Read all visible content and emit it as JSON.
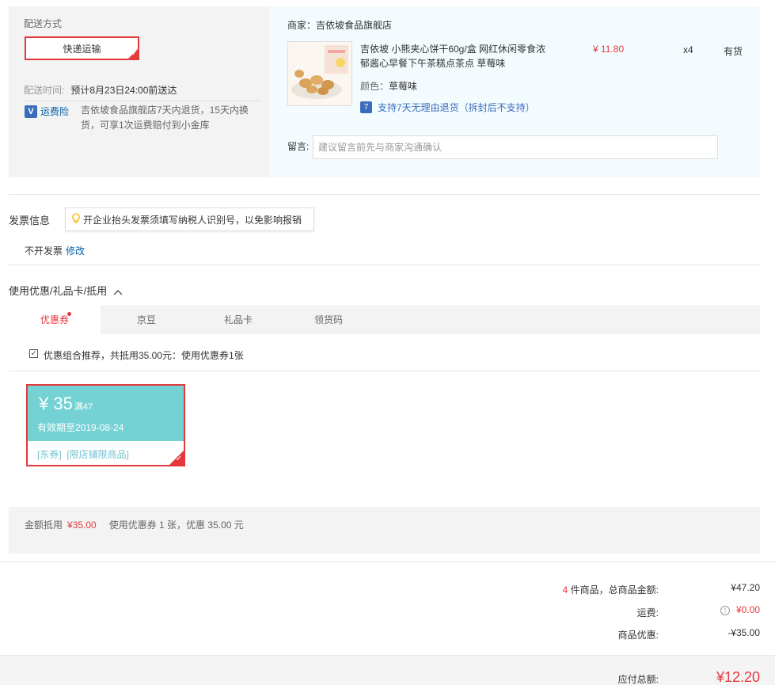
{
  "delivery": {
    "label": "配送方式",
    "method": "快递运输",
    "time_label": "配送时间:",
    "time_value": "预计8月23日24:00前送达",
    "insurance_icon": "V",
    "insurance_link": "运费险",
    "insurance_text": "吉依坡食品旗舰店7天内退货，15天内换货，可享1次运费赔付到小金库"
  },
  "shop": {
    "merchant": "商家：吉依坡食品旗舰店",
    "product_name": "吉依坡 小熊夹心饼干60g/盒 网红休闲零食浓郁酱心早餐下午茶糕点茶点 草莓味",
    "price": "¥ 11.80",
    "qty": "x4",
    "stock": "有货",
    "color_label": "颜色：",
    "color_value": "草莓味",
    "return_icon": "7",
    "return_text": "支持7天无理由退货（拆封后不支持）",
    "memo_label": "留言:",
    "memo_placeholder": "建议留言前先与商家沟通确认"
  },
  "invoice": {
    "title": "发票信息",
    "tip": "开企业抬头发票须填写纳税人识别号，以免影响报销",
    "status": "不开发票",
    "edit": "修改"
  },
  "coupon": {
    "title": "使用优惠/礼品卡/抵用",
    "tabs": [
      "优惠券",
      "京豆",
      "礼品卡",
      "领货码"
    ],
    "combo_text": "优惠组合推荐，共抵用35.00元：使用优惠券1张",
    "card": {
      "amount": "¥ 35",
      "threshold": "满47",
      "expire": "有效期至2019-08-24",
      "tags": "[东券]  [限店铺限商品]"
    },
    "summary_label": "金额抵用",
    "summary_amount": "¥35.00",
    "summary_used": "使用优惠券 1 张，优惠 35.00 元"
  },
  "totals": {
    "count": "4",
    "count_label": " 件商品，总商品金额:",
    "goods_total": "¥47.20",
    "freight_label": "运费:",
    "freight_value": "¥0.00",
    "discount_label": "商品优惠:",
    "discount_value": "-¥35.00",
    "pay_label": "应付总额:",
    "pay_value": "¥12.20"
  },
  "colors": {
    "accent_red": "#e4393c",
    "link_blue": "#005ea7",
    "coupon_teal": "#74d2d4"
  }
}
